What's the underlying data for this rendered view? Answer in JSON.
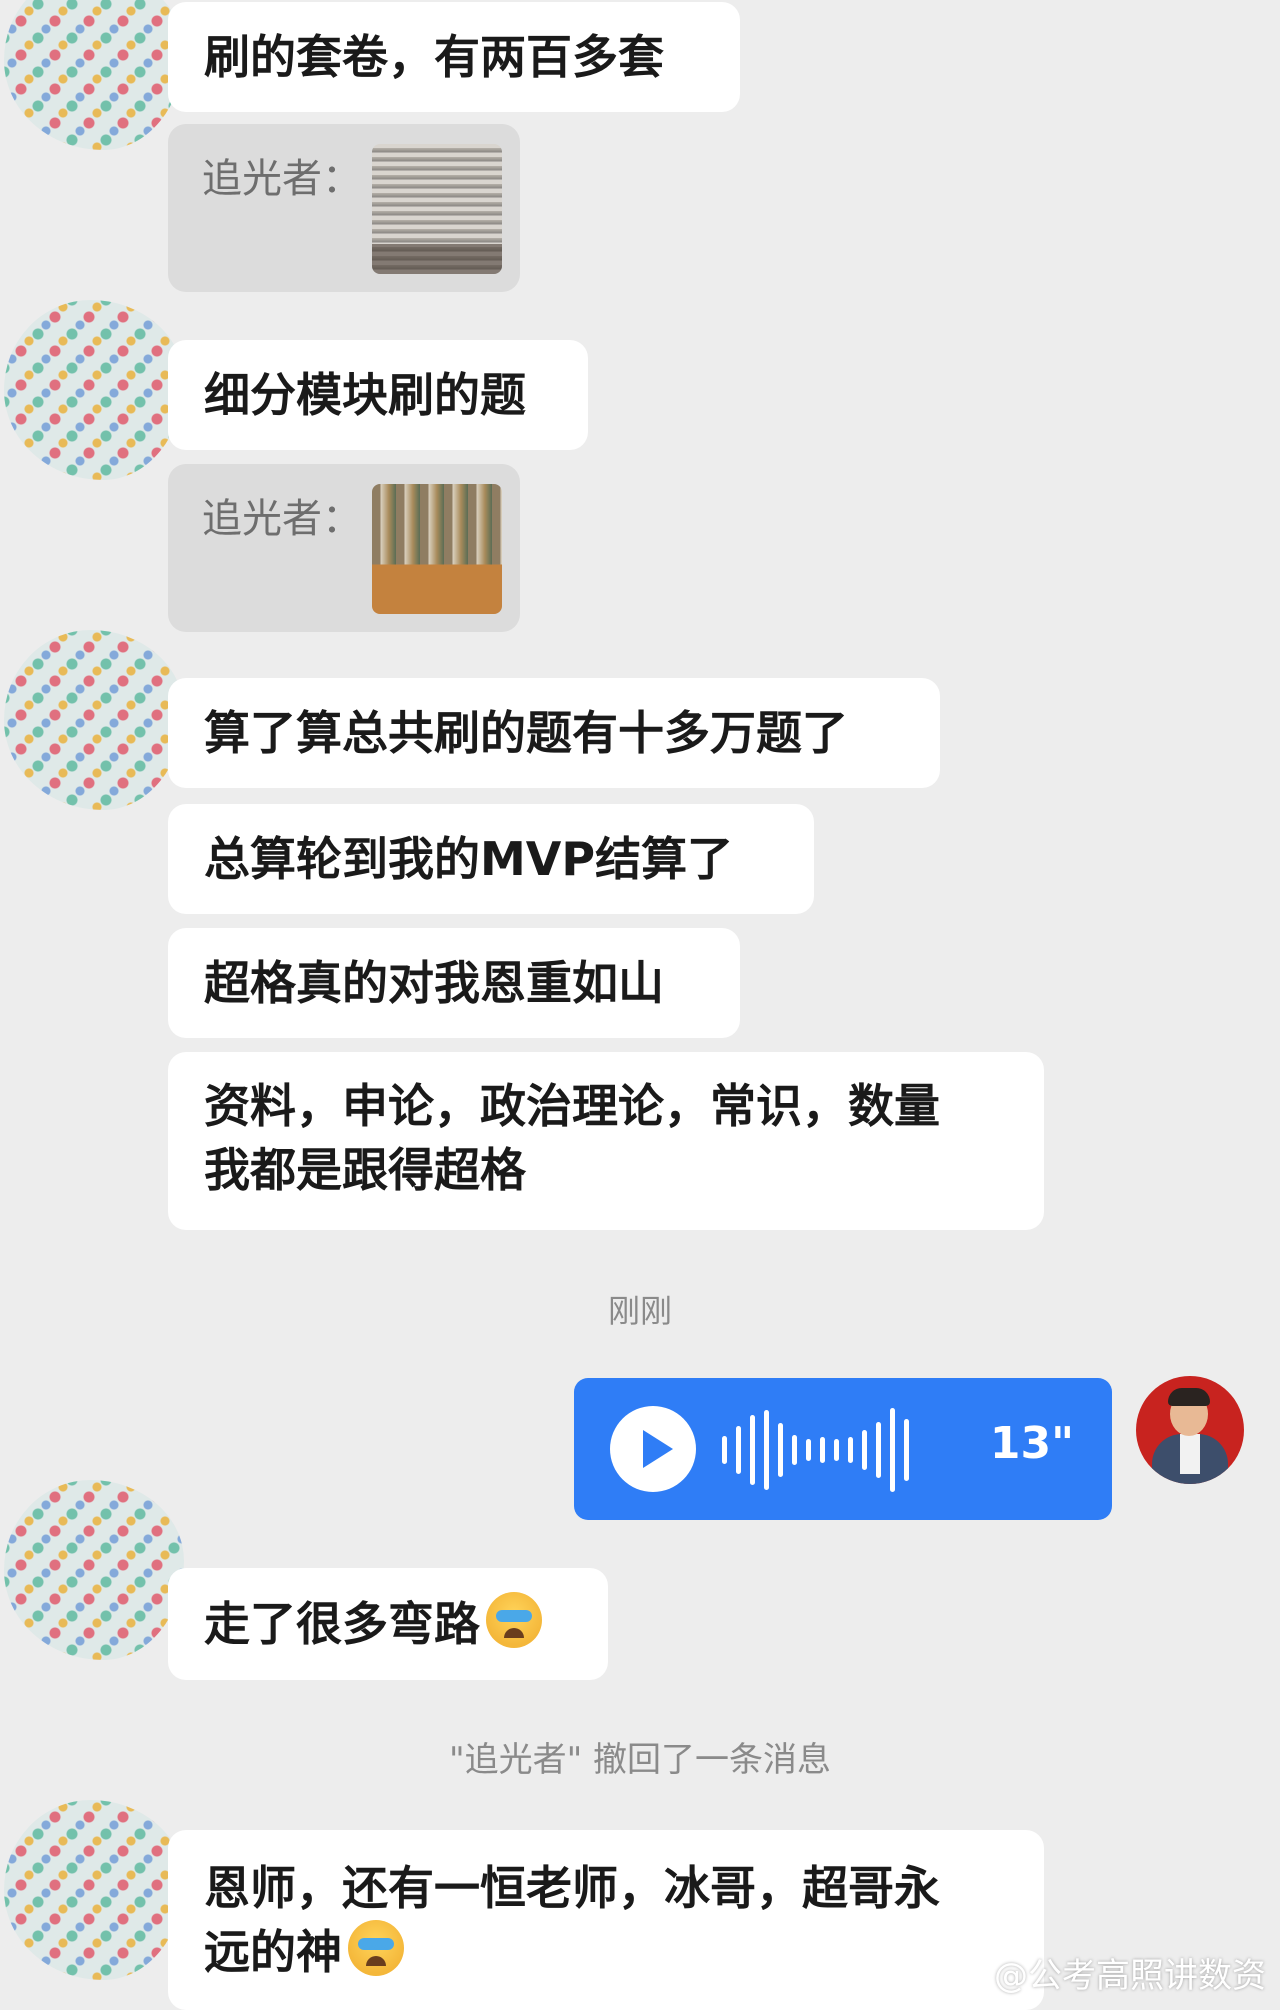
{
  "messages": {
    "m1": "刷的套卷，有两百多套",
    "q1_sender": "追光者：",
    "m2": "细分模块刷的题",
    "q2_sender": "追光者：",
    "m3": "算了算总共刷的题有十多万题了",
    "m4": "总算轮到我的MVP结算了",
    "m5": "超格真的对我恩重如山",
    "m6_line1": "资料，申论，政治理论，常识，数量",
    "m6_line2": "我都是跟得超格",
    "time": "刚刚",
    "voice_duration": "13\"",
    "m7": "走了很多弯路",
    "recall": "\"追光者\" 撤回了一条消息",
    "m8_line1": "恩师，还有一恒老师，冰哥，超哥永",
    "m8_line2": "远的神"
  },
  "emoji": {
    "icon": "crying-face-icon"
  },
  "watermark": "@公考高照讲数资",
  "colors": {
    "voice_bubble": "#2f7df6",
    "background": "#ededed"
  }
}
